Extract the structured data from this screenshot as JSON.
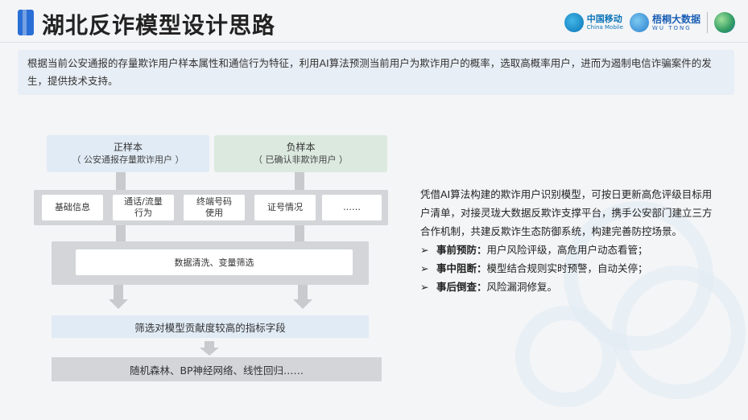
{
  "title": "湖北反诈模型设计思路",
  "logos": {
    "china_mobile_cn": "中国移动",
    "china_mobile_en": "China Mobile",
    "wutong_cn": "梧桐大数据",
    "wutong_en": "WU TONG"
  },
  "intro": "根据当前公安通报的存量欺诈用户样本属性和通信行为特征，利用AI算法预测当前用户为欺诈用户的概率，选取高概率用户，进而为遏制电信诈骗案件的发生，提供技术支持。",
  "samples": {
    "positive": {
      "title": "正样本",
      "subtitle": "（ 公安通报存量欺诈用户 ）"
    },
    "negative": {
      "title": "负样本",
      "subtitle": "（ 已确认非欺诈用户 ）"
    }
  },
  "attributes": [
    "基础信息",
    "通话/流量\n行为",
    "终端号码\n使用",
    "证号情况",
    "……"
  ],
  "cleaning": "数据清洗、变量筛选",
  "filter": "筛选对模型贡献度较高的指标字段",
  "models": "随机森林、BP神经网络、线性回归……",
  "right": {
    "paragraph": "凭借AI算法构建的欺诈用户识别模型，可按日更新高危评级目标用户清单，对接灵珑大数据反欺诈支撑平台，携手公安部门建立三方合作机制，共建反欺诈生态防御系统，构建完善防控场景。",
    "bullets": [
      {
        "label": "事前预防：",
        "text": "用户风险评级，高危用户动态看管；"
      },
      {
        "label": "事中阻断：",
        "text": "模型结合规则实时预警，自动关停；"
      },
      {
        "label": "事后倒查：",
        "text": "风险漏洞修复。"
      }
    ],
    "bullet_glyph": "➢"
  },
  "colors": {
    "accent": "#2a6fd6",
    "positive_bg": "#e1ebf5",
    "negative_bg": "#dbe9df",
    "gray_block": "#d3d5d8"
  }
}
